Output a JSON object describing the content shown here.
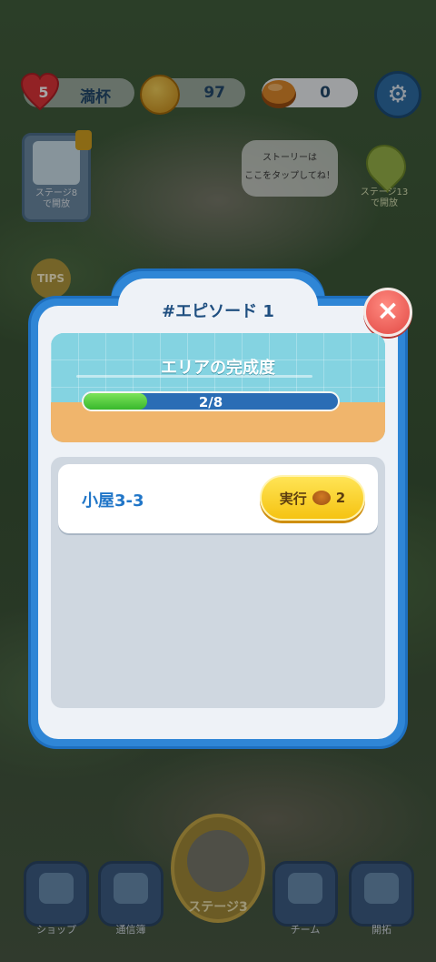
{
  "hud": {
    "lives": "5",
    "lives_status": "満杯",
    "coins": "97",
    "dorayaki": "0"
  },
  "side": {
    "locked_stage_label": "ステージ8\nで開放",
    "story_bubble": "ストーリーは\nここをタップしてね！",
    "stage_pin_label": "ステージ13\nで開放",
    "tips_label": "TIPS"
  },
  "dialog": {
    "title": "#エピソード 1",
    "area_label": "エリアの完成度",
    "progress_text": "2/8",
    "progress_fraction": 0.25,
    "tasks": [
      {
        "name": "小屋3-3",
        "button_label": "実行",
        "cost": "2"
      }
    ]
  },
  "nav": {
    "shop": "ショップ",
    "rank": "通信簿",
    "stage": "ステージ3",
    "team": "チーム",
    "open": "開拓"
  },
  "colors": {
    "dialog_frame": "#2f86d6",
    "progress_fill": "#38b82c",
    "run_button": "#f5c312",
    "close_button": "#e24a45"
  }
}
